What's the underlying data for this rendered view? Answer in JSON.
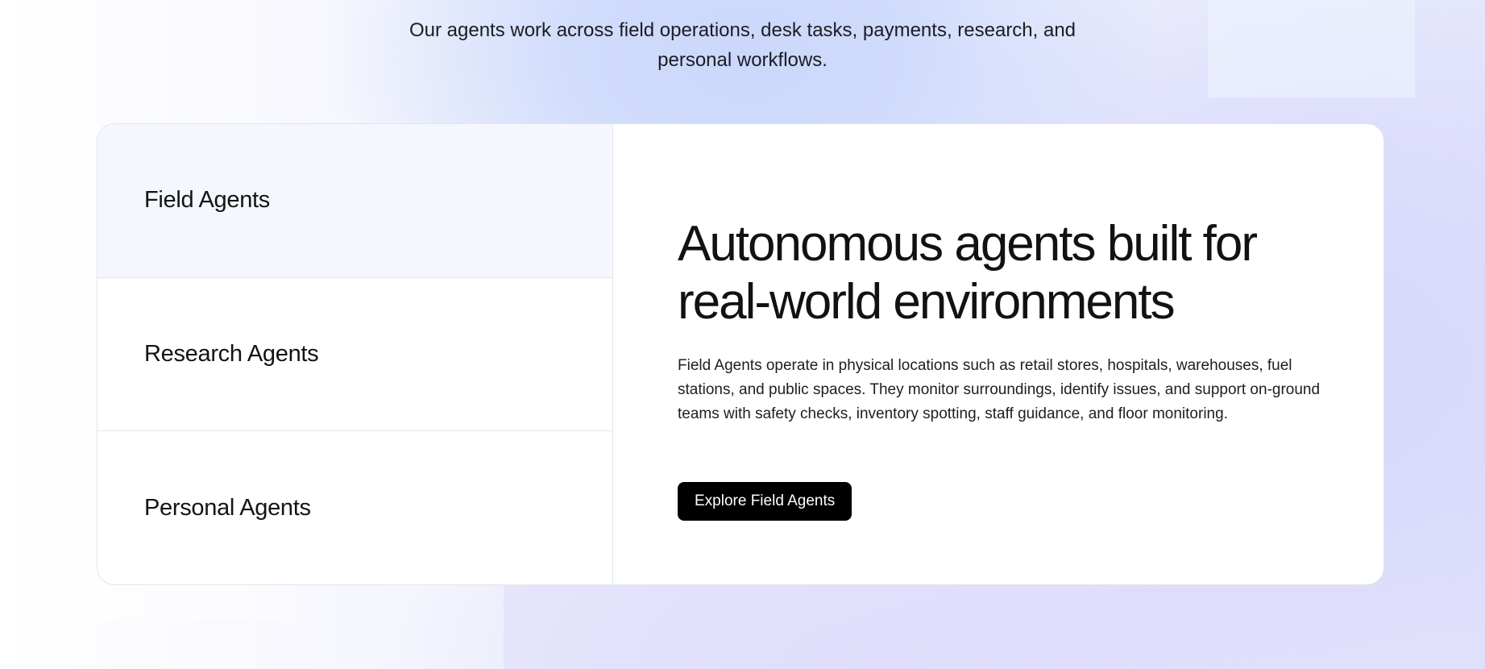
{
  "intro": {
    "line1": "Our agents work across field operations, desk tasks, payments, research, and",
    "line2": "personal workflows."
  },
  "tabs": [
    {
      "label": "Field Agents",
      "active": true
    },
    {
      "label": "Research Agents",
      "active": false
    },
    {
      "label": "Personal Agents",
      "active": false
    }
  ],
  "panel": {
    "headline_line1": "Autonomous agents built for",
    "headline_line2": "real-world environments",
    "description": "Field Agents operate in physical locations such as retail stores, hospitals, warehouses, fuel stations, and public spaces. They monitor surroundings, identify issues, and support on-ground teams with safety checks, inventory spotting, staff guidance, and floor monitoring.",
    "cta_label": "Explore Field Agents"
  },
  "colors": {
    "accent_bg": "#cbd8fb",
    "active_tab_bg": "#f4f7fe",
    "cta_bg": "#000000",
    "cta_text": "#ffffff"
  }
}
